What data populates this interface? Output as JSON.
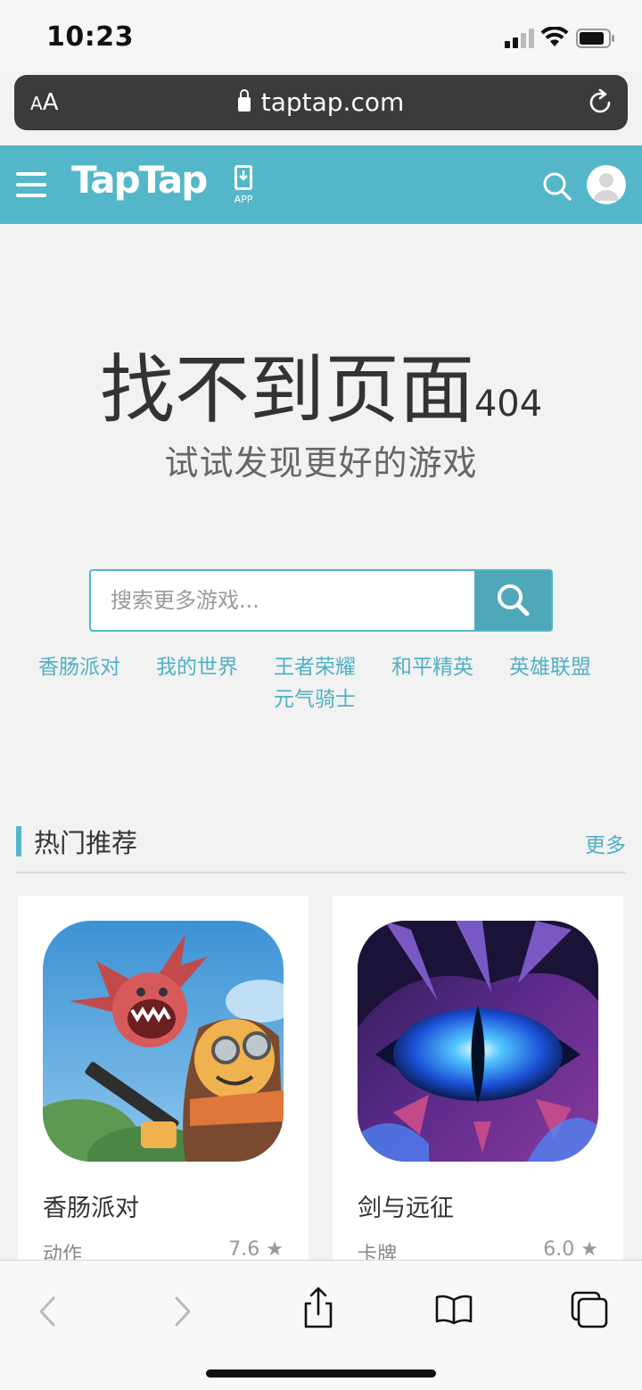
{
  "status_bar": {
    "time": "10:23"
  },
  "browser": {
    "aa_small": "A",
    "aa_large": "A",
    "url": "taptap.com"
  },
  "header": {
    "logo": "TapTap",
    "app_label": "APP"
  },
  "not_found": {
    "title": "找不到页面",
    "code": "404",
    "subtitle": "试试发现更好的游戏"
  },
  "search": {
    "placeholder": "搜索更多游戏..."
  },
  "hot_tags": [
    "香肠派对",
    "我的世界",
    "王者荣耀",
    "和平精英",
    "英雄联盟",
    "元气骑士"
  ],
  "hot_section": {
    "title": "热门推荐",
    "more": "更多",
    "games": [
      {
        "name": "香肠派对",
        "category": "动作",
        "score": "7.6"
      },
      {
        "name": "剑与远征",
        "category": "卡牌",
        "score": "6.0"
      }
    ]
  },
  "colors": {
    "brand": "#54b7c9",
    "search_button": "#4ea8b9",
    "link": "#4fb0c4"
  }
}
